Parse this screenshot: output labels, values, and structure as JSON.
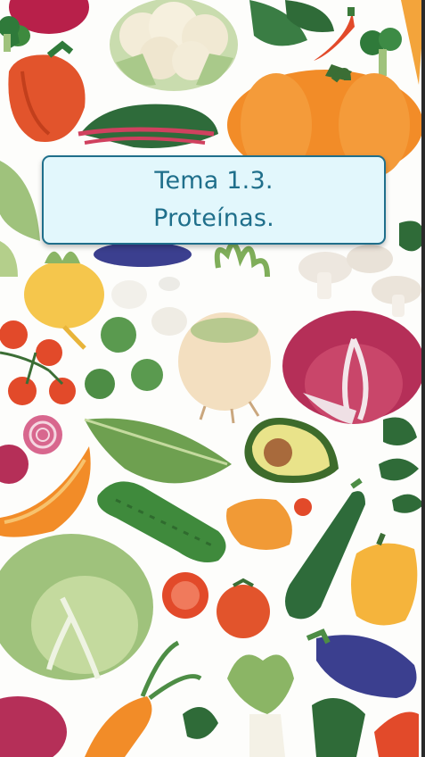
{
  "title_card": {
    "line1": "Tema 1.3.",
    "line2": "Proteínas."
  },
  "background": {
    "illustrations": [
      "beet-icon",
      "cauliflower-icon",
      "leafy-greens-icon",
      "chili-pepper-icon",
      "carrot-icon",
      "red-bell-pepper-icon",
      "broccoli-icon",
      "pumpkin-icon",
      "chard-icon",
      "turnip-icon",
      "mushroom-icon",
      "garlic-icon",
      "cherry-tomato-icon",
      "brussels-sprout-icon",
      "celery-root-icon",
      "radicchio-icon",
      "onion-icon",
      "kale-leaf-icon",
      "avocado-icon",
      "melon-slice-icon",
      "cucumber-icon",
      "physalis-icon",
      "zucchini-icon",
      "yellow-pepper-icon",
      "cabbage-icon",
      "tomato-icon",
      "eggplant-icon",
      "bok-choy-icon"
    ],
    "colors": {
      "card_fill": "#e2f7fc",
      "card_border": "#1f6f8b",
      "title_text": "#1f6f8b"
    }
  }
}
